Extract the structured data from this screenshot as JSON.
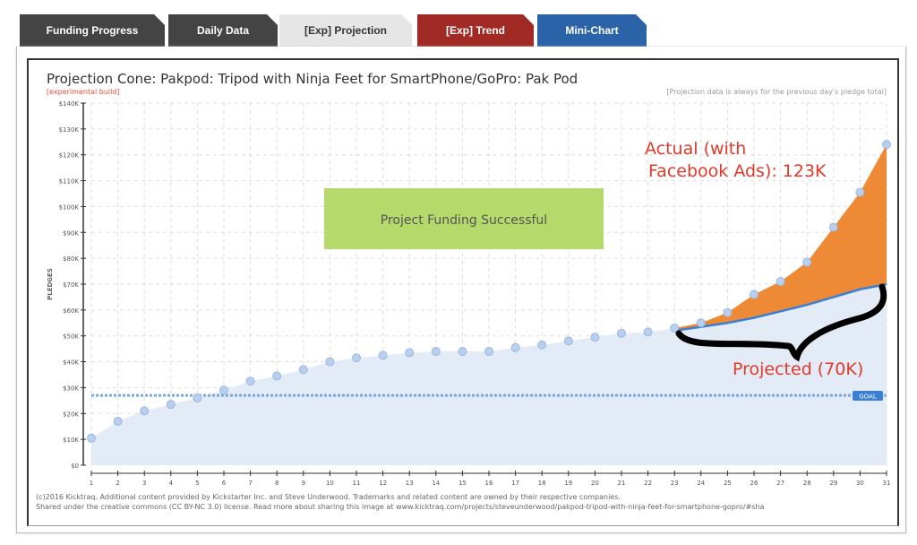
{
  "tabs": [
    {
      "label": "Funding Progress",
      "color": "#444444"
    },
    {
      "label": "Daily Data",
      "color": "#444444"
    },
    {
      "label": "[Exp] Projection",
      "color": "#e6e6e6",
      "active": true
    },
    {
      "label": "[Exp] Trend",
      "color": "#a12a25"
    },
    {
      "label": "Mini-Chart",
      "color": "#2b63a8"
    }
  ],
  "header": {
    "title": "Projection Cone: Pakpod: Tripod with Ninja Feet for SmartPhone/GoPro: Pak Pod",
    "subtitle": "[experimental build]",
    "note": "[Projection data is always for the previous day's pledge total]"
  },
  "banner": "Project Funding Successful",
  "annotations": {
    "actual": [
      "Actual (with",
      "Facebook Ads): 123K"
    ],
    "projected": "Projected (70K)",
    "goal": "GOAL"
  },
  "footer": [
    "(c)2016 Kicktraq. Additional content provided by Kickstarter Inc. and Steve Underwood. Trademarks and related content are owned by their respective companies.",
    "Shared under the creative commons (CC BY-NC 3.0) license. Read more about sharing this image at www.kicktraq.com/projects/steveunderwood/pakpod-tripod-with-ninja-feet-for-smartphone-gopro/#sha"
  ],
  "chart_data": {
    "type": "area",
    "ylabel": "PLEDGES",
    "ylim": [
      0,
      140000
    ],
    "yticks": [
      "$0",
      "$10K",
      "$20K",
      "$30K",
      "$40K",
      "$50K",
      "$60K",
      "$70K",
      "$80K",
      "$90K",
      "$100K",
      "$110K",
      "$120K",
      "$130K",
      "$140K"
    ],
    "x": [
      1,
      2,
      3,
      4,
      5,
      6,
      7,
      8,
      9,
      10,
      11,
      12,
      13,
      14,
      15,
      16,
      17,
      18,
      19,
      20,
      21,
      22,
      23,
      24,
      25,
      26,
      27,
      28,
      29,
      30,
      31
    ],
    "grid": true,
    "goal": 27000,
    "series": [
      {
        "values": [
          10500,
          17000,
          21000,
          23500,
          26000,
          29000,
          32500,
          34500,
          37000,
          40000,
          41500,
          42500,
          43500,
          44000,
          44000,
          44000,
          45500,
          46500,
          48000,
          49500,
          51000,
          51500,
          53000,
          55000,
          59000,
          66000,
          71000,
          78500,
          92000,
          105500,
          124000
        ],
        "color": "#a9c4e8"
      },
      {
        "x": [
          23,
          24,
          25,
          26,
          27,
          28,
          29,
          30,
          31
        ],
        "values": [
          52000,
          53500,
          55000,
          57000,
          59500,
          62000,
          65000,
          68000,
          70000
        ],
        "color": "#3b7fd4"
      }
    ],
    "highlight_color": "#ee8a35"
  }
}
